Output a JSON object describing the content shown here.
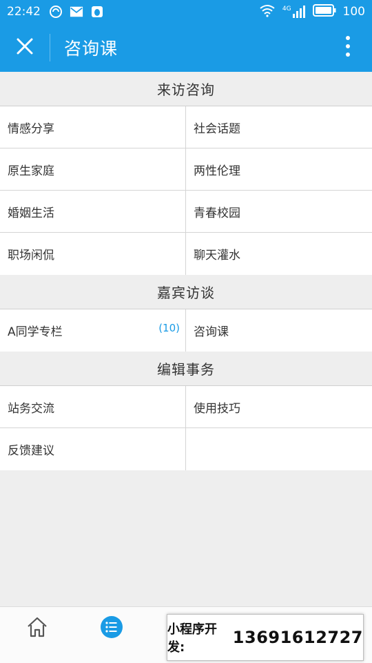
{
  "status_bar": {
    "time": "22:42",
    "network": "4G",
    "battery": "100",
    "icons": [
      "alarm-icon",
      "mail-icon",
      "qq-icon",
      "wifi-icon",
      "signal-icon",
      "battery-icon"
    ]
  },
  "app_bar": {
    "title": "咨询课",
    "close_icon": "close-icon",
    "more_icon": "more-vertical-icon"
  },
  "sections": [
    {
      "title": "来访咨询",
      "items": [
        {
          "label": "情感分享"
        },
        {
          "label": "社会话题"
        },
        {
          "label": "原生家庭"
        },
        {
          "label": "两性伦理"
        },
        {
          "label": "婚姻生活"
        },
        {
          "label": "青春校园"
        },
        {
          "label": "职场闲侃"
        },
        {
          "label": "聊天灌水"
        }
      ]
    },
    {
      "title": "嘉宾访谈",
      "items": [
        {
          "label": "A同学专栏",
          "badge": "(10)"
        },
        {
          "label": "咨询课"
        }
      ]
    },
    {
      "title": "编辑事务",
      "items": [
        {
          "label": "站务交流"
        },
        {
          "label": "使用技巧"
        },
        {
          "label": "反馈建议"
        },
        {
          "label": ""
        }
      ]
    }
  ],
  "bottom_nav": {
    "items": [
      "home-icon",
      "list-icon"
    ],
    "active_color": "#1a9be5"
  },
  "promo": {
    "label": "小程序开发:",
    "phone": "13691612727"
  },
  "colors": {
    "primary": "#1a9be5",
    "background": "#eeeeee"
  }
}
